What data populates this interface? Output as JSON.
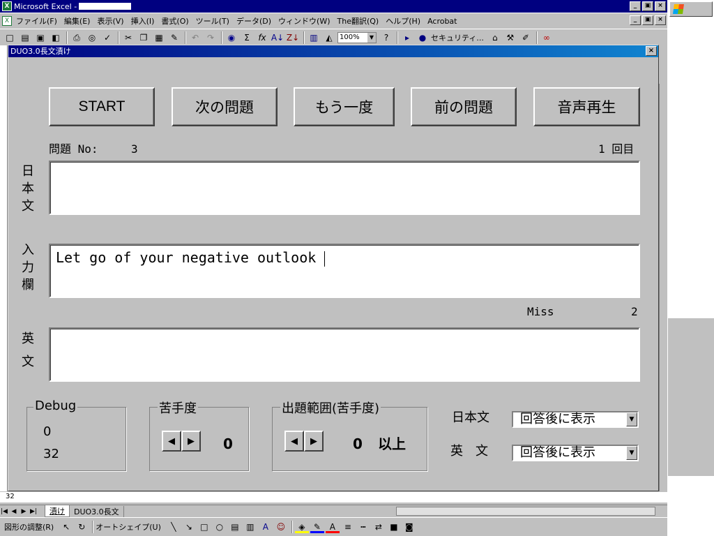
{
  "window": {
    "title": "Microsoft Excel - ",
    "app_icon": "excel-icon",
    "min": "_",
    "restore": "▣",
    "close": "×"
  },
  "menu": [
    "ファイル(F)",
    "編集(E)",
    "表示(V)",
    "挿入(I)",
    "書式(O)",
    "ツール(T)",
    "データ(D)",
    "ウィンドウ(W)",
    "The翻訳(Q)",
    "ヘルプ(H)",
    "Acrobat"
  ],
  "toolbar": {
    "zoom": "100%",
    "security_label": "セキュリティ...",
    "sigma": "Σ",
    "fx": "fx"
  },
  "dialog": {
    "title": "DUO3.0長文漬け",
    "buttons": {
      "start": "START",
      "next": "次の問題",
      "again": "もう一度",
      "prev": "前の問題",
      "play": "音声再生"
    },
    "problem_label": "問題 No:",
    "problem_no": "3",
    "round": "1 回目",
    "japanese_label": [
      "日",
      "本",
      "文"
    ],
    "japanese_text": "",
    "input_label": [
      "入",
      "力",
      "欄"
    ],
    "input_text": "Let go of your negative outlook ",
    "miss_label": "Miss",
    "miss_count": "2",
    "english_label": [
      "英",
      "文"
    ],
    "english_text": "",
    "debug": {
      "title": "Debug",
      "v1": "0",
      "v2": "32"
    },
    "difficulty": {
      "title": "苦手度",
      "value": "0"
    },
    "range": {
      "title": "出題範囲(苦手度)",
      "value": "0",
      "suffix": "以上"
    },
    "jp_display": {
      "label": "日本文",
      "value": "回答後に表示"
    },
    "en_display": {
      "label": "英　文",
      "value": "回答後に表示"
    }
  },
  "sheet": {
    "row_number": "32",
    "tabs": [
      "漬け",
      "DUO3.0長文"
    ]
  },
  "drawbar": {
    "adjust": "図形の調整(R)",
    "autoshape": "オートシェイプ(U)"
  }
}
